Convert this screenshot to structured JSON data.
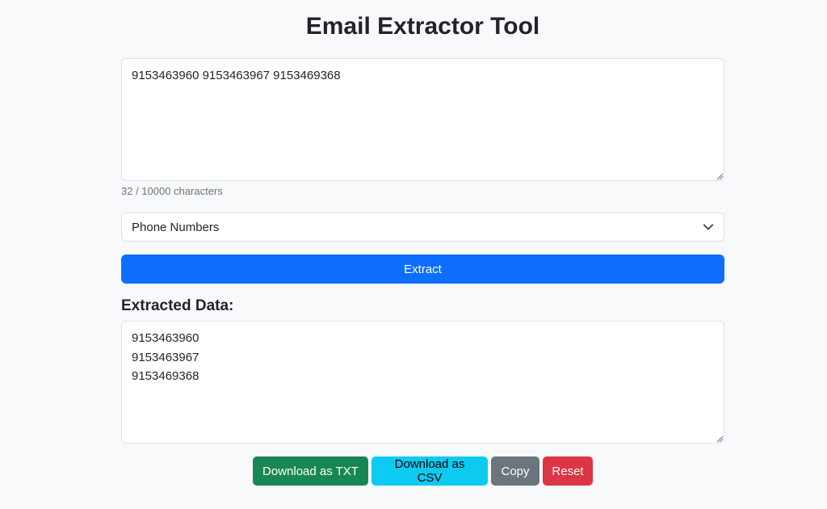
{
  "header": {
    "title": "Email Extractor Tool"
  },
  "input": {
    "value": "9153463960 9153463967 9153469368",
    "char_count": "32 / 10000 characters"
  },
  "type_select": {
    "selected": "Phone Numbers"
  },
  "extract_button": {
    "label": "Extract"
  },
  "output": {
    "label": "Extracted Data:",
    "value": "9153463960\n9153463967\n9153469368"
  },
  "actions": {
    "download_txt": "Download as TXT",
    "download_csv": "Download as CSV",
    "copy": "Copy",
    "reset": "Reset"
  },
  "colors": {
    "primary": "#0d6efd",
    "success": "#198754",
    "info": "#0dcaf0",
    "secondary": "#6c757d",
    "danger": "#dc3545"
  }
}
